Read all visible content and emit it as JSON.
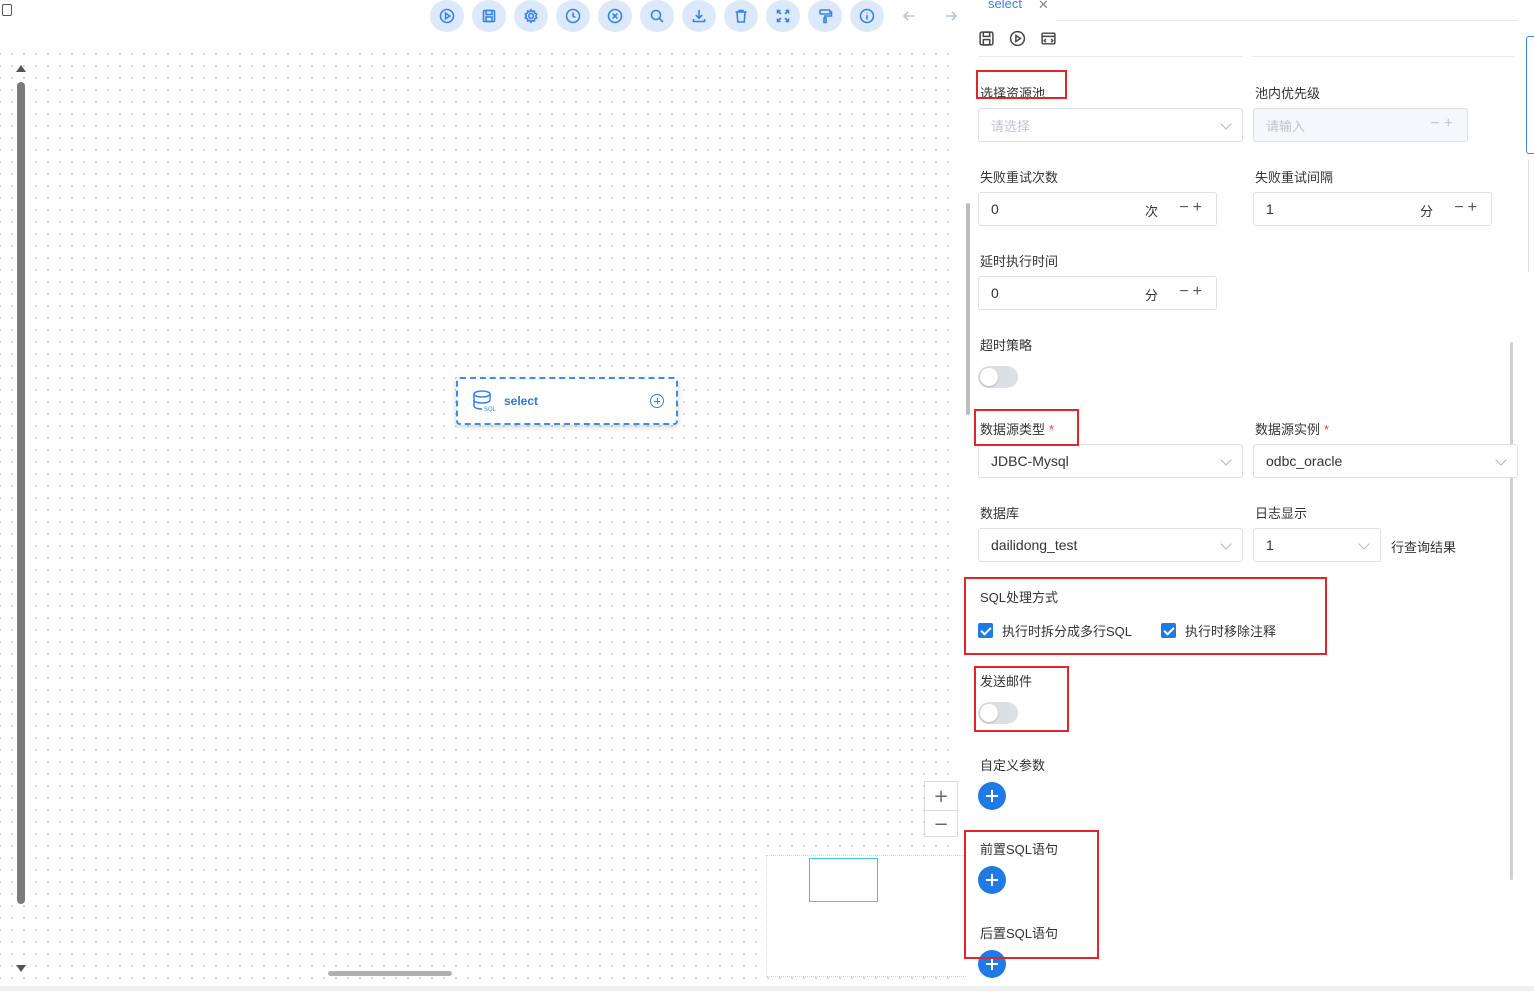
{
  "toolbar": {
    "buttons": [
      "run-icon",
      "save-icon",
      "settings-icon",
      "clock-icon",
      "close-circle-icon",
      "search-icon",
      "download-icon",
      "trash-icon",
      "fit-view-icon",
      "format-painter-icon",
      "info-icon"
    ],
    "nav": [
      "back-arrow-icon",
      "forward-arrow-icon"
    ]
  },
  "node": {
    "label": "select",
    "icon": "database-sql-icon"
  },
  "zoom": {
    "plus": "+",
    "minus": "−"
  },
  "panel": {
    "tab_label": "select",
    "tab_close": "✕",
    "tools": [
      "save-icon",
      "play-icon",
      "code-preview-icon"
    ],
    "resource_pool": {
      "label": "选择资源池",
      "placeholder": "请选择"
    },
    "pool_priority": {
      "label": "池内优先级",
      "placeholder": "请输入"
    },
    "retry_times": {
      "label": "失败重试次数",
      "value": "0",
      "unit": "次"
    },
    "retry_interval": {
      "label": "失败重试间隔",
      "value": "1",
      "unit": "分"
    },
    "delay_time": {
      "label": "延时执行时间",
      "value": "0",
      "unit": "分"
    },
    "timeout_strategy": {
      "label": "超时策略",
      "enabled": false
    },
    "datasource_type": {
      "label": "数据源类型",
      "required": "*",
      "value": "JDBC-Mysql"
    },
    "datasource_instance": {
      "label": "数据源实例",
      "required": "*",
      "value": "odbc_oracle"
    },
    "database": {
      "label": "数据库",
      "value": "dailidong_test"
    },
    "log_display": {
      "label": "日志显示",
      "value": "1",
      "suffix": "行查询结果"
    },
    "sql_mode": {
      "label": "SQL处理方式",
      "options": [
        {
          "label": "执行时拆分成多行SQL",
          "checked": true
        },
        {
          "label": "执行时移除注释",
          "checked": true
        }
      ]
    },
    "send_email": {
      "label": "发送邮件",
      "enabled": false
    },
    "custom_params": {
      "label": "自定义参数"
    },
    "pre_sql": {
      "label": "前置SQL语句"
    },
    "post_sql": {
      "label": "后置SQL语句"
    }
  },
  "colors": {
    "accent": "#1f7ae6",
    "highlight": "#e0262c",
    "toolbar_bg": "#dbe9fb"
  }
}
